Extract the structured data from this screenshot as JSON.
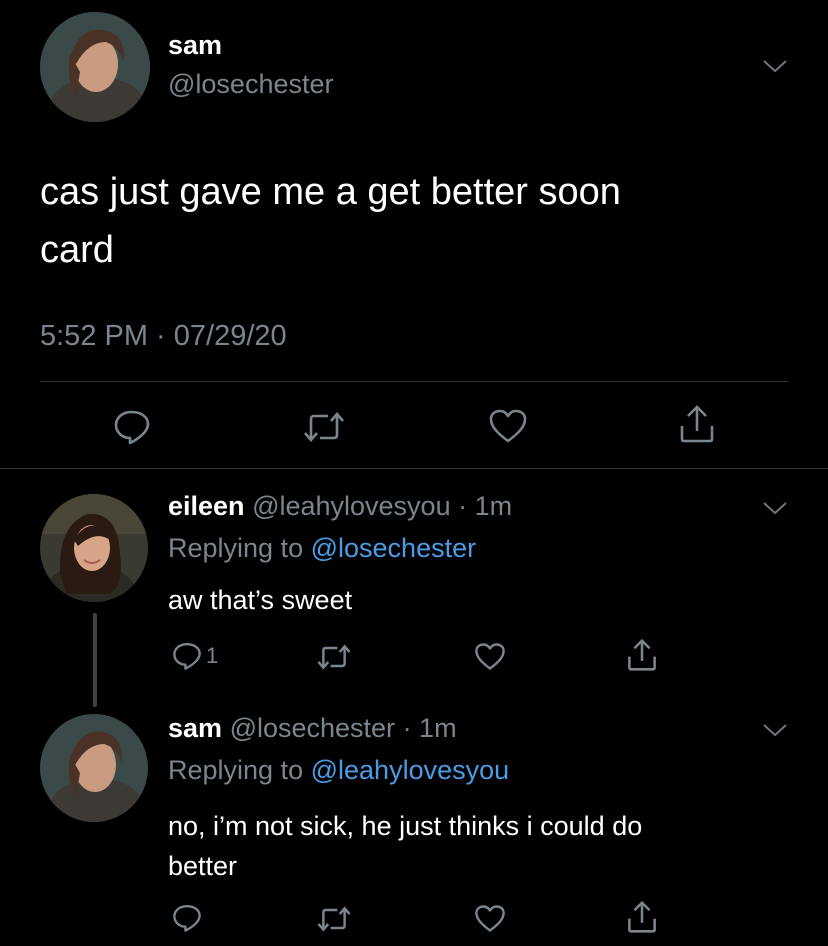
{
  "main_tweet": {
    "display_name": "sam",
    "handle": "@losechester",
    "text_line1": "cas just gave me a get better soon",
    "text_line2": "card",
    "timestamp": "5:52 PM · 07/29/20",
    "avatar_icon": "avatar-photo-sam"
  },
  "replies": [
    {
      "display_name": "eileen",
      "handle": "@leahylovesyou",
      "age": "· 1m",
      "replying_prefix": "Replying to",
      "replying_handle": "@losechester",
      "text": "aw that’s sweet",
      "reply_count": "1",
      "avatar_icon": "avatar-photo-eileen"
    },
    {
      "display_name": "sam",
      "handle": "@losechester",
      "age": "· 1m",
      "replying_prefix": "Replying to",
      "replying_handle": "@leahylovesyou",
      "text_line1": "no, i’m not sick, he just thinks i could do",
      "text_line2": "better",
      "reply_count": "",
      "avatar_icon": "avatar-photo-sam"
    }
  ],
  "colors": {
    "background": "#000000",
    "secondary_text": "#7b858d",
    "link": "#4a9ce6",
    "divider": "#2f3336"
  },
  "icons": [
    "reply-icon",
    "retweet-icon",
    "like-icon",
    "share-icon",
    "chevron-down-icon"
  ]
}
